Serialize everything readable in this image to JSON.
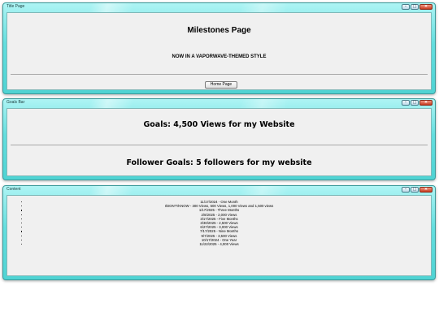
{
  "windows": {
    "title_page": {
      "title": "Title Page",
      "heading": "Milestones Page",
      "subheading": "NOW IN A VAPORWAVE-THEMED STYLE",
      "home_button": "Home Page"
    },
    "goals_bar": {
      "title": "Goals Bar",
      "views_goal": "Goals: 4,500 Views for my Website",
      "follower_goal": "Follower Goals: 5 followers for my website"
    },
    "content": {
      "title": "Content",
      "milestones": [
        "11/17/2024 - One Month",
        "I/DON'T/KNOW - 300 Views, 500 Views, 1,000 Views and 1,500 views",
        "1/17/2025 - Three Months",
        "2/8/2025 - 2,000 Views",
        "3/17/2025 - Five Months",
        "3/30/2025 - 2,500 Views",
        "6/27/2025 - 3,000 Views",
        "7/17/2025 - Nine Months",
        "9/7/2025 - 3,500 Views",
        "10/17/2024 - One Year",
        "11/22/2025 - 4,000 Views"
      ]
    }
  },
  "window_controls": {
    "minimize": "–",
    "maximize": "□",
    "close": "×"
  },
  "colors": {
    "frame": "#63dede",
    "client": "#f0f0f0",
    "close_button": "#c8391e"
  }
}
